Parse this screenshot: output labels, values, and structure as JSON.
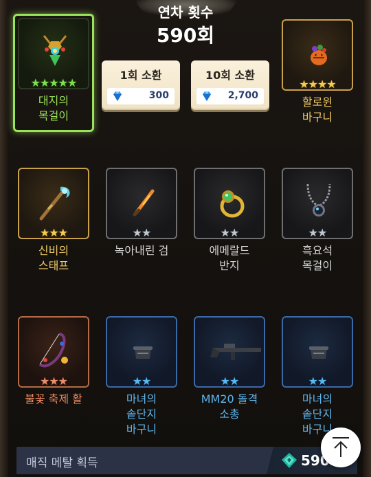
{
  "header": {
    "count_label": "연차 횟수",
    "count_value": "590회"
  },
  "summon_buttons": [
    {
      "label": "1회 소환",
      "cost": "300"
    },
    {
      "label": "10회 소환",
      "cost": "2,700"
    }
  ],
  "items": [
    {
      "name_line1": "대지의",
      "name_line2": "목걸이",
      "stars": "★★★★★",
      "rarity": "green",
      "icon": "amulet-icon"
    },
    {
      "name_line1": "할로윈",
      "name_line2": "바구니",
      "stars": "★★★★",
      "rarity": "gold",
      "icon": "pumpkin-basket-icon"
    },
    {
      "name_line1": "신비의",
      "name_line2": "스태프",
      "stars": "★★★",
      "rarity": "gold",
      "icon": "staff-icon"
    },
    {
      "name_line1": "녹아내린 검",
      "name_line2": "",
      "stars": "★★",
      "rarity": "gray",
      "icon": "sword-icon"
    },
    {
      "name_line1": "에메랄드",
      "name_line2": "반지",
      "stars": "★★",
      "rarity": "gray",
      "icon": "ring-icon"
    },
    {
      "name_line1": "흑요석",
      "name_line2": "목걸이",
      "stars": "★★",
      "rarity": "gray",
      "icon": "necklace-icon"
    },
    {
      "name_line1": "불꽃 축제 활",
      "name_line2": "",
      "stars": "★★★",
      "rarity": "copper",
      "icon": "bow-icon"
    },
    {
      "name_line1": "마녀의",
      "name_line2": "솥단지",
      "name_line3": "바구니",
      "stars": "★★",
      "rarity": "blue",
      "icon": "cauldron-icon"
    },
    {
      "name_line1": "MM20 돌격",
      "name_line2": "소총",
      "stars": "★★",
      "rarity": "blue",
      "icon": "rifle-icon"
    },
    {
      "name_line1": "마녀의",
      "name_line2": "솥단지",
      "name_line3": "바구니",
      "stars": "★★",
      "rarity": "blue",
      "icon": "cauldron-icon"
    }
  ],
  "bottom_bar": {
    "label": "매직 메탈 획득",
    "value": "5900"
  },
  "colors": {
    "selected_border": "#9be35a",
    "gold": "#c9a14a",
    "blue": "#3c69a8",
    "gray": "#6f6f70",
    "copper": "#b36b46"
  }
}
